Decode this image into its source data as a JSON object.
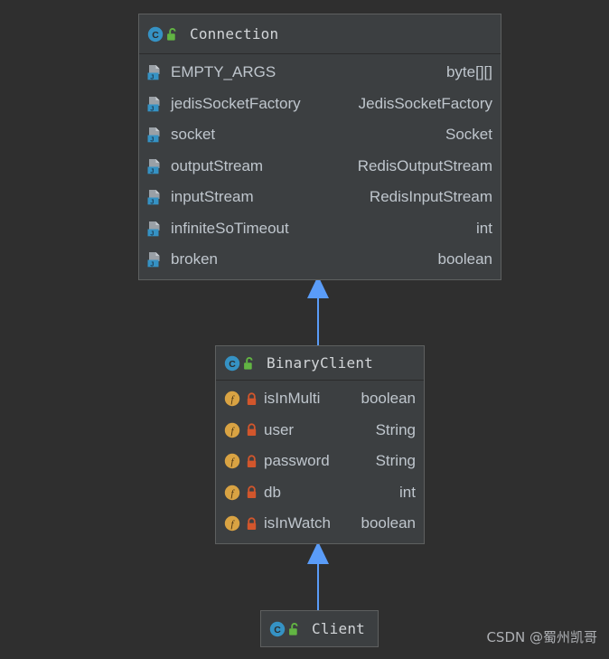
{
  "diagram": {
    "kind": "uml-class-diagram",
    "background_color": "#2f2f2f",
    "box_fill_color": "#3c3f41",
    "box_border_color": "#5e6060",
    "text_color": "#bfc6cd",
    "arrow_color": "#5a9cf8",
    "class_icon_color": "#3592c4",
    "public_lock_color": "#62b543",
    "private_lock_color": "#d2562c",
    "field_icon_color": "#3592c4",
    "field_circle_color": "#d9a343"
  },
  "classes": [
    {
      "id": "connection",
      "name": "Connection",
      "icon": "class-icon",
      "visibility_icon": "unlock-public-icon",
      "fields": [
        {
          "name": "EMPTY_ARGS",
          "type": "byte[][]",
          "icon": "java-field-icon"
        },
        {
          "name": "jedisSocketFactory",
          "type": "JedisSocketFactory",
          "icon": "java-field-icon"
        },
        {
          "name": "socket",
          "type": "Socket",
          "icon": "java-field-icon"
        },
        {
          "name": "outputStream",
          "type": "RedisOutputStream",
          "icon": "java-field-icon"
        },
        {
          "name": "inputStream",
          "type": "RedisInputStream",
          "icon": "java-field-icon"
        },
        {
          "name": "infiniteSoTimeout",
          "type": "int",
          "icon": "java-field-icon"
        },
        {
          "name": "broken",
          "type": "boolean",
          "icon": "java-field-icon"
        }
      ]
    },
    {
      "id": "binaryclient",
      "name": "BinaryClient",
      "icon": "class-icon",
      "visibility_icon": "unlock-public-icon",
      "fields": [
        {
          "name": "isInMulti",
          "type": "boolean",
          "icon": "field-circle-icon",
          "visibility_icon": "lock-private-icon"
        },
        {
          "name": "user",
          "type": "String",
          "icon": "field-circle-icon",
          "visibility_icon": "lock-private-icon"
        },
        {
          "name": "password",
          "type": "String",
          "icon": "field-circle-icon",
          "visibility_icon": "lock-private-icon"
        },
        {
          "name": "db",
          "type": "int",
          "icon": "field-circle-icon",
          "visibility_icon": "lock-private-icon"
        },
        {
          "name": "isInWatch",
          "type": "boolean",
          "icon": "field-circle-icon",
          "visibility_icon": "lock-private-icon"
        }
      ]
    },
    {
      "id": "client",
      "name": "Client",
      "icon": "class-icon",
      "visibility_icon": "unlock-public-icon",
      "fields": []
    }
  ],
  "relations": [
    {
      "id": "rel-binaryclient-connection",
      "type": "generalization",
      "from": "BinaryClient",
      "to": "Connection",
      "arrow_label": "inheritance-arrow-up"
    },
    {
      "id": "rel-client-binaryclient",
      "type": "generalization",
      "from": "Client",
      "to": "BinaryClient",
      "arrow_label": "inheritance-arrow-up"
    }
  ],
  "watermark": {
    "text": "CSDN @蜀州凯哥"
  }
}
